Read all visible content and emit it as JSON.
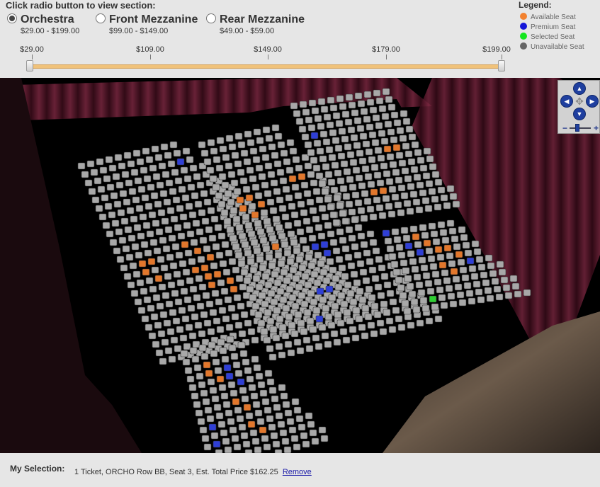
{
  "header": {
    "instruction": "Click radio button to view section:",
    "sections": [
      {
        "name": "Orchestra",
        "price": "$29.00 - $199.00",
        "checked": true
      },
      {
        "name": "Front Mezzanine",
        "price": "$99.00 - $149.00",
        "checked": false
      },
      {
        "name": "Rear Mezzanine",
        "price": "$49.00 - $59.00",
        "checked": false
      }
    ]
  },
  "legend": {
    "title": "Legend:",
    "items": [
      {
        "label": "Available Seat",
        "color": "#f2812e"
      },
      {
        "label": "Premium Seat",
        "color": "#1416d8"
      },
      {
        "label": "Selected Seat",
        "color": "#14e61e"
      },
      {
        "label": "Unavailable Seat",
        "color": "#666666"
      }
    ]
  },
  "price_slider": {
    "ticks": [
      "$29.00",
      "$109.00",
      "$149.00",
      "$179.00",
      "$199.00"
    ],
    "min_selected": "$29.00",
    "max_selected": "$199.00"
  },
  "colors": {
    "available": "#e2772c",
    "premium": "#2f3fd6",
    "selected": "#2ecf32",
    "unavailable": "#a8a8a8",
    "curtain": "#6b1f34",
    "stage": "#5a4a3c"
  },
  "map_nav": {
    "up": "▲",
    "down": "▼",
    "left": "◀",
    "right": "▶",
    "center": "✥",
    "zoom_out": "−",
    "zoom_in": "+"
  },
  "selection": {
    "label": "My Selection:",
    "text": "1 Ticket, ORCHO Row BB, Seat 3, Est. Total Price $162.25",
    "remove": "Remove"
  }
}
